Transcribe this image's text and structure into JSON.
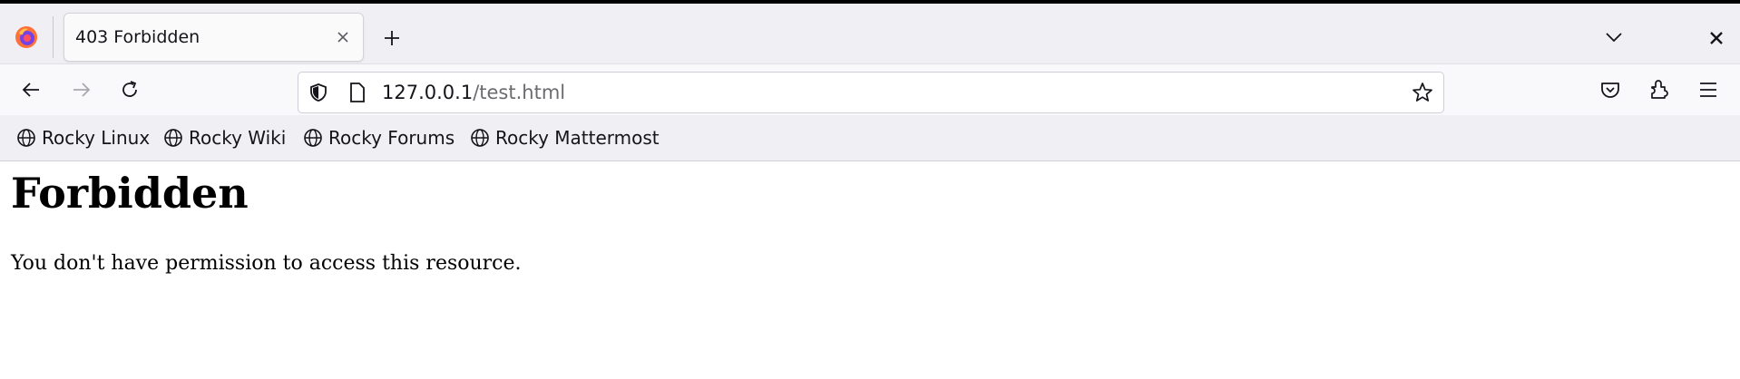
{
  "browser": {
    "logo_icon": "firefox-logo-icon",
    "tab": {
      "title": "403 Forbidden",
      "close_icon": "close-icon"
    },
    "new_tab_icon": "plus-icon",
    "tab_list_icon": "chevron-down-icon",
    "window_close_icon": "close-icon"
  },
  "navbar": {
    "back_icon": "arrow-left-icon",
    "forward_icon": "arrow-right-icon",
    "reload_icon": "reload-icon",
    "url": {
      "host": "127.0.0.1",
      "path": "/test.html"
    },
    "bookmark_icon": "star-icon",
    "tools": [
      "pocket-icon",
      "extensions-icon",
      "hamburger-menu-icon"
    ]
  },
  "bookmarks": [
    {
      "label": "Rocky Linux"
    },
    {
      "label": "Rocky Wiki"
    },
    {
      "label": "Rocky Forums"
    },
    {
      "label": "Rocky Mattermost"
    }
  ],
  "page": {
    "heading": "Forbidden",
    "message": "You don't have permission to access this resource."
  },
  "colors": {
    "accent": "#15141a",
    "tabstrip": "#f0f0f4",
    "navbar": "#f9f9fb"
  }
}
